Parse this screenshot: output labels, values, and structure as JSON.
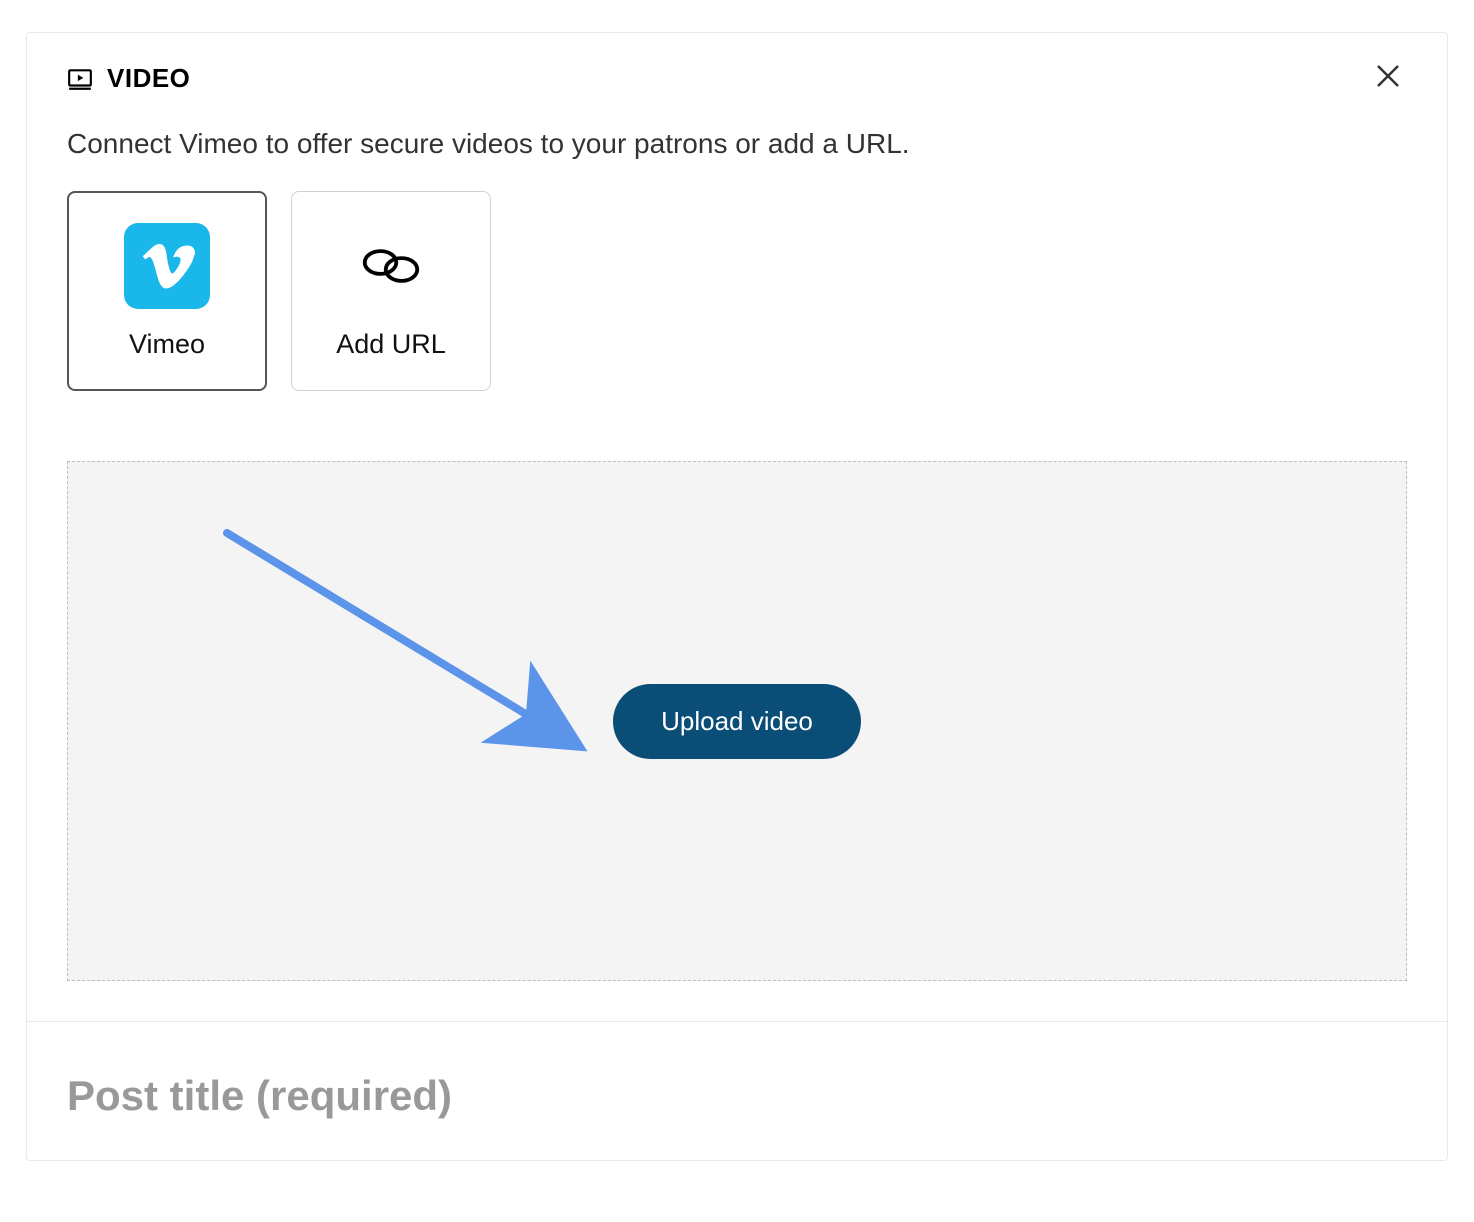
{
  "header": {
    "title": "VIDEO"
  },
  "description": "Connect Vimeo to offer secure videos to your patrons or add a URL.",
  "options": {
    "vimeo_label": "Vimeo",
    "addurl_label": "Add URL"
  },
  "upload": {
    "button_label": "Upload video"
  },
  "post": {
    "title_placeholder": "Post title (required)"
  },
  "colors": {
    "vimeo_brand": "#1ab7ea",
    "upload_btn_bg": "#0a4e78",
    "arrow": "#5b94e8"
  }
}
